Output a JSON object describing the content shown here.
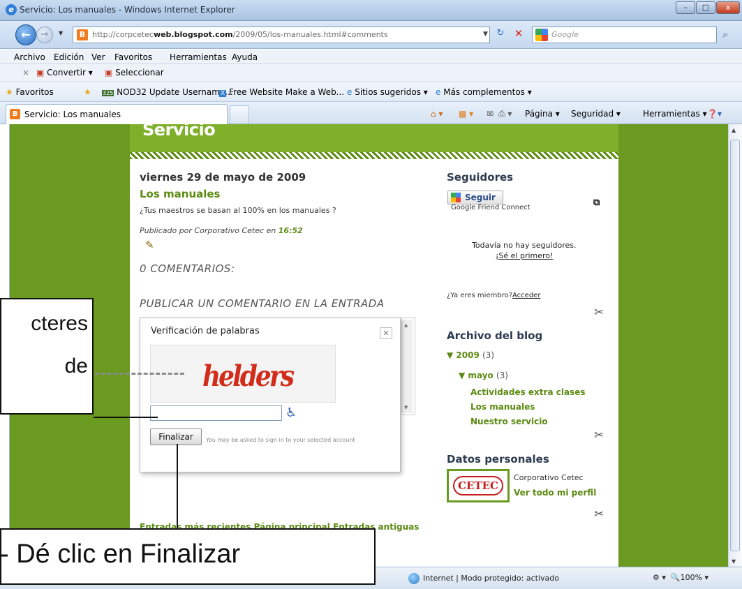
{
  "window": {
    "title": "Servicio: Los manuales - Windows Internet Explorer",
    "minimize": "–",
    "maximize": "□",
    "close": "x"
  },
  "address_bar": {
    "url_prefix": "http://corpcetec",
    "url_domain": "web.blogspot.com",
    "url_path": "/2009/05/los-manuales.html#comments",
    "search_placeholder": "Google"
  },
  "menu": [
    "Archivo",
    "Edición",
    "Ver",
    "Favoritos",
    "Herramientas",
    "Ayuda"
  ],
  "command_bar": {
    "convert": "Convertir",
    "select": "Seleccionar"
  },
  "favorites_bar": {
    "favorites": "Favoritos",
    "items": [
      "NOD32 Update Username...",
      "Free Website Make a Web...",
      "Sitios sugeridos",
      "Más complementos"
    ]
  },
  "tab": {
    "label": "Servicio: Los manuales"
  },
  "toolbar_right": {
    "page": "Página",
    "security": "Seguridad",
    "tools": "Herramientas"
  },
  "blog": {
    "title": "Servicio",
    "post": {
      "date": "viernes 29 de mayo de 2009",
      "title": "Los manuales",
      "body": "¿Tus maestros se basan al 100% en los manuales ?",
      "meta_prefix": "Publicado por Corporativo Cetec en ",
      "meta_time": "16:52",
      "comments_heading": "0 COMENTARIOS:",
      "post_comment_heading": "PUBLICAR UN COMENTARIO EN LA ENTRADA"
    },
    "word_verification": {
      "title": "Verificación de palabras",
      "captcha_word": "helders",
      "input_value": "",
      "finalize_button": "Finalizar",
      "note": "You may be asked to sign in to your selected account"
    },
    "nav_links": "Entradas más recientes    Página principal    Entradas antiguas"
  },
  "sidebar": {
    "followers_heading": "Seguidores",
    "follow_button": "Seguir",
    "gfc": "Google Friend Connect",
    "no_followers": "Todavía no hay seguidores.",
    "be_first": "¡Sé el primero!",
    "member_prefix": "¿Ya eres miembro?",
    "member_link": "Acceder",
    "archive_heading": "Archivo del blog",
    "archive_year": "2009",
    "archive_year_count": "(3)",
    "archive_month": "mayo",
    "archive_month_count": "(3)",
    "archive_posts": [
      "Actividades extra clases",
      "Los manuales",
      "Nuestro servicio"
    ],
    "personal_heading": "Datos personales",
    "profile_logo_text": "CETEC",
    "profile_name": "Corporativo Cetec",
    "profile_link": "Ver todo mi perfil"
  },
  "status_bar": {
    "zone": "Internet | Modo protegido: activado",
    "zoom": "100%"
  },
  "annotations": {
    "callout1_line1": "cteres",
    "callout1_line2": "de",
    "callout2": "- Dé clic en Finalizar"
  }
}
